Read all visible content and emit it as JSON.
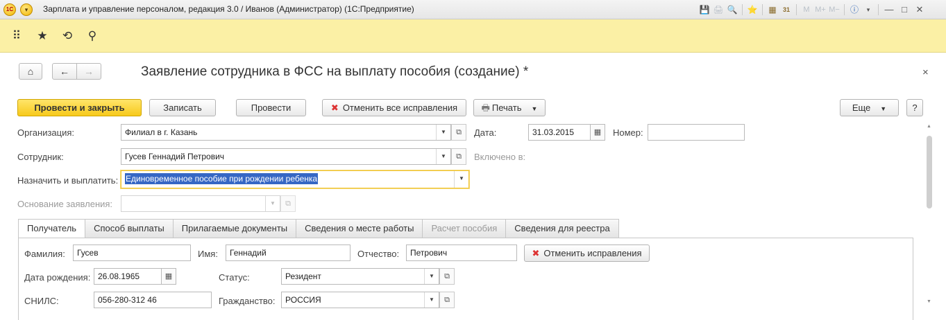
{
  "window": {
    "title": "Зарплата и управление персоналом, редакция 3.0 / Иванов (Администратор)  (1С:Предприятие)",
    "logo_text": "1С",
    "menu_glyph": "▾",
    "toolbar_glyphs": [
      "💾",
      "🖨",
      "🔍",
      "⭐",
      "▦",
      "31",
      "M",
      "M+",
      "M−",
      "ⓘ",
      "▾"
    ],
    "minimize": "—",
    "maximize": "□",
    "close": "✕"
  },
  "section_panel": {
    "icons": [
      "apps-grid-icon",
      "star-icon",
      "history-icon",
      "search-icon"
    ],
    "glyphs": [
      "⠿",
      "★",
      "⟲",
      "⚲"
    ]
  },
  "form": {
    "title": "Заявление сотрудника в ФСС на выплату пособия (создание) *",
    "home_glyph": "⌂",
    "back_glyph": "←",
    "forward_glyph": "→",
    "close_glyph": "×",
    "buttons": {
      "post_and_close": "Провести и закрыть",
      "save": "Записать",
      "post": "Провести",
      "cancel_corrections": "Отменить все исправления",
      "print": "Печать",
      "more": "Еще",
      "help": "?"
    },
    "fields": {
      "organization_label": "Организация:",
      "organization_value": "Филиал в г. Казань",
      "date_label": "Дата:",
      "date_value": "31.03.2015",
      "number_label": "Номер:",
      "number_value": "",
      "employee_label": "Сотрудник:",
      "employee_value": "Гусев Геннадий Петрович",
      "included_label": "Включено в:",
      "assign_label": "Назначить и выплатить:",
      "assign_value": "Единовременное пособие при рождении ребенка",
      "basis_label": "Основание заявления:",
      "basis_value": ""
    },
    "tabs": [
      {
        "label": "Получатель",
        "active": true,
        "disabled": false
      },
      {
        "label": "Способ выплаты",
        "active": false,
        "disabled": false
      },
      {
        "label": "Прилагаемые документы",
        "active": false,
        "disabled": false
      },
      {
        "label": "Сведения о месте работы",
        "active": false,
        "disabled": false
      },
      {
        "label": "Расчет пособия",
        "active": false,
        "disabled": true
      },
      {
        "label": "Сведения для реестра",
        "active": false,
        "disabled": false
      }
    ],
    "recipient": {
      "surname_label": "Фамилия:",
      "surname_value": "Гусев",
      "name_label": "Имя:",
      "name_value": "Геннадий",
      "patronymic_label": "Отчество:",
      "patronymic_value": "Петрович",
      "cancel_corrections": "Отменить исправления",
      "birth_label": "Дата рождения:",
      "birth_value": "26.08.1965",
      "status_label": "Статус:",
      "status_value": "Резидент",
      "snils_label": "СНИЛС:",
      "snils_value": "056-280-312 46",
      "citizenship_label": "Гражданство:",
      "citizenship_value": "РОССИЯ"
    }
  }
}
